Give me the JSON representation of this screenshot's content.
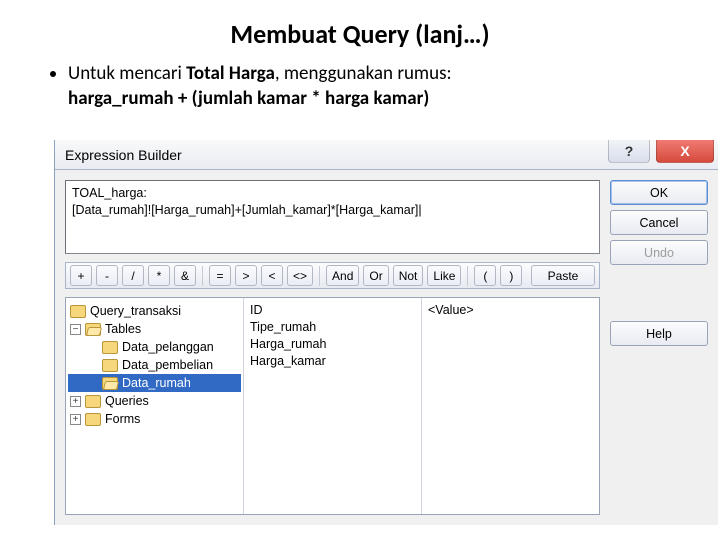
{
  "slide": {
    "title": "Membuat  Query (lanj…)",
    "bullet_prefix": "Untuk mencari ",
    "bullet_bold": "Total Harga",
    "bullet_suffix": ", menggunakan rumus:",
    "formula": "harga_rumah + (jumlah kamar * harga kamar)"
  },
  "window": {
    "title": "Expression Builder",
    "help_btn": "?",
    "close_btn": "X"
  },
  "buttons": {
    "ok": "OK",
    "cancel": "Cancel",
    "undo": "Undo",
    "paste": "Paste",
    "help": "Help"
  },
  "expression": {
    "line1": "TOAL_harga:",
    "line2": "[Data_rumah]![Harga_rumah]+[Jumlah_kamar]*[Harga_kamar]|"
  },
  "ops": {
    "plus": "+",
    "minus": "-",
    "div": "/",
    "mul": "*",
    "amp": "&",
    "eq": "=",
    "gt": ">",
    "lt": "<",
    "ne": "<>",
    "and": "And",
    "or": "Or",
    "not": "Not",
    "like": "Like",
    "lp": "(",
    "rp": ")"
  },
  "tree": {
    "n0": "Query_transaksi",
    "n1": "Tables",
    "n1a": "Data_pelanggan",
    "n1b": "Data_pembelian",
    "n1c": "Data_rumah",
    "n2": "Queries",
    "n3": "Forms"
  },
  "fields": {
    "f0": "ID",
    "f1": "Tipe_rumah",
    "f2": "Harga_rumah",
    "f3": "Harga_kamar"
  },
  "values": {
    "v0": "<Value>"
  }
}
